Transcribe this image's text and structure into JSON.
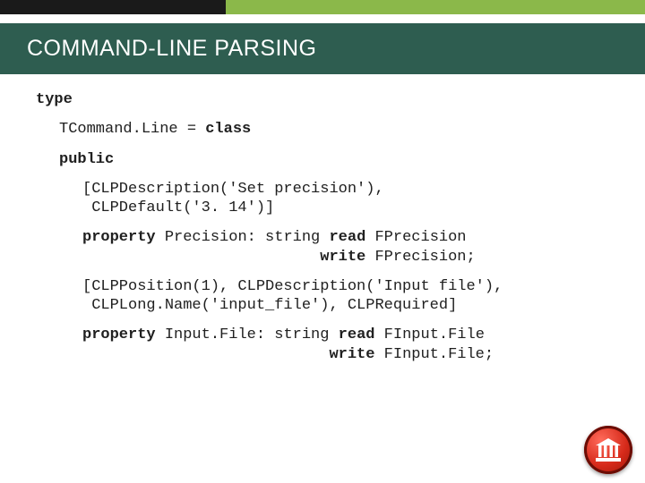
{
  "title": "COMMAND-LINE PARSING",
  "code": {
    "l0": "type",
    "l1a": "TCommand.Line = ",
    "l1a_kw": "class",
    "l1b": "public",
    "l2a": "[CLPDescription('Set precision'),\n CLPDefault('3. 14')]",
    "l2b_kw1": "property",
    "l2b_mid": " Precision: string ",
    "l2b_kw2": "read",
    "l2b_tail": " FPrecision\n                          ",
    "l2b_kw3": "write",
    "l2b_end": " FPrecision;",
    "l2c": "[CLPPosition(1), CLPDescription('Input file'),\n CLPLong.Name('input_file'), CLPRequired]",
    "l2d_kw1": "property",
    "l2d_mid": " Input.File: string ",
    "l2d_kw2": "read",
    "l2d_tail": " FInput.File\n                           ",
    "l2d_kw3": "write",
    "l2d_end": " FInput.File;"
  }
}
